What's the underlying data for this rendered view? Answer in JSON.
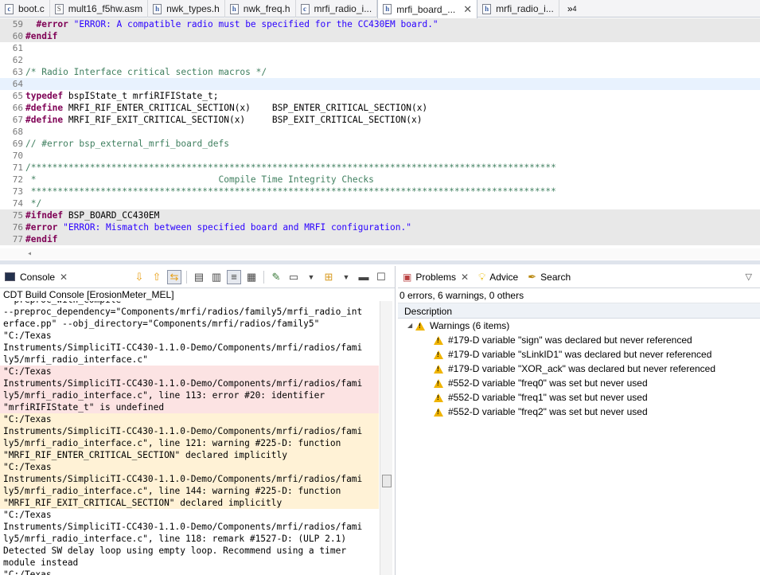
{
  "editor_tabs": [
    {
      "label": "boot.c",
      "icon": "c-file-icon"
    },
    {
      "label": "mult16_f5hw.asm",
      "icon": "asm-file-icon"
    },
    {
      "label": "nwk_types.h",
      "icon": "header-file-icon"
    },
    {
      "label": "nwk_freq.h",
      "icon": "header-file-icon"
    },
    {
      "label": "mrfi_radio_i...",
      "icon": "c-file-icon"
    },
    {
      "label": "mrfi_board_...",
      "icon": "header-file-icon",
      "active": true
    },
    {
      "label": "mrfi_radio_i...",
      "icon": "header-file-icon"
    }
  ],
  "tab_overflow": {
    "glyph": "»",
    "count": "4"
  },
  "code_lines": [
    {
      "n": "59",
      "text": "  #error \"ERROR: A compatible radio must be specified for the CC430EM board.\"",
      "style": "grey"
    },
    {
      "n": "60",
      "text": "#endif",
      "style": "grey"
    },
    {
      "n": "61",
      "text": "",
      "style": ""
    },
    {
      "n": "62",
      "text": "",
      "style": ""
    },
    {
      "n": "63",
      "text": "/* Radio Interface critical section macros */",
      "style": ""
    },
    {
      "n": "64",
      "text": "",
      "style": "cur"
    },
    {
      "n": "65",
      "text": "typedef bspIState_t mrfiRIFIState_t;",
      "style": ""
    },
    {
      "n": "66",
      "text": "#define MRFI_RIF_ENTER_CRITICAL_SECTION(x)    BSP_ENTER_CRITICAL_SECTION(x)",
      "style": ""
    },
    {
      "n": "67",
      "text": "#define MRFI_RIF_EXIT_CRITICAL_SECTION(x)     BSP_EXIT_CRITICAL_SECTION(x)",
      "style": ""
    },
    {
      "n": "68",
      "text": "",
      "style": ""
    },
    {
      "n": "69",
      "text": "// #error bsp_external_mrfi_board_defs",
      "style": ""
    },
    {
      "n": "70",
      "text": "",
      "style": ""
    },
    {
      "n": "71",
      "text": "/**************************************************************************************************",
      "style": ""
    },
    {
      "n": "72",
      "text": " *                                  Compile Time Integrity Checks",
      "style": ""
    },
    {
      "n": "73",
      "text": " **************************************************************************************************",
      "style": ""
    },
    {
      "n": "74",
      "text": " */",
      "style": ""
    },
    {
      "n": "75",
      "text": "#ifndef BSP_BOARD_CC430EM",
      "style": "grey"
    },
    {
      "n": "76",
      "text": "#error \"ERROR: Mismatch between specified board and MRFI configuration.\"",
      "style": "grey"
    },
    {
      "n": "77",
      "text": "#endif",
      "style": "grey"
    }
  ],
  "console": {
    "tab_label": "Console",
    "title": "CDT Build Console [ErosionMeter_MEL]",
    "lines": [
      {
        "text": "--preproc_with_compile",
        "kind": ""
      },
      {
        "text": "--preproc_dependency=\"Components/mrfi/radios/family5/mrfi_radio_int",
        "kind": ""
      },
      {
        "text": "erface.pp\" --obj_directory=\"Components/mrfi/radios/family5\"",
        "kind": ""
      },
      {
        "text": "\"C:/Texas",
        "kind": ""
      },
      {
        "text": "Instruments/SimpliciTI-CC430-1.1.0-Demo/Components/mrfi/radios/fami",
        "kind": ""
      },
      {
        "text": "ly5/mrfi_radio_interface.c\"",
        "kind": ""
      },
      {
        "text": "\"C:/Texas",
        "kind": "err"
      },
      {
        "text": "Instruments/SimpliciTI-CC430-1.1.0-Demo/Components/mrfi/radios/fami",
        "kind": "err"
      },
      {
        "text": "ly5/mrfi_radio_interface.c\", line 113: error #20: identifier",
        "kind": "err"
      },
      {
        "text": "\"mrfiRIFIState_t\" is undefined",
        "kind": "err"
      },
      {
        "text": "\"C:/Texas",
        "kind": "warn"
      },
      {
        "text": "Instruments/SimpliciTI-CC430-1.1.0-Demo/Components/mrfi/radios/fami",
        "kind": "warn"
      },
      {
        "text": "ly5/mrfi_radio_interface.c\", line 121: warning #225-D: function",
        "kind": "warn"
      },
      {
        "text": "\"MRFI_RIF_ENTER_CRITICAL_SECTION\" declared implicitly",
        "kind": "warn"
      },
      {
        "text": "\"C:/Texas",
        "kind": "warn"
      },
      {
        "text": "Instruments/SimpliciTI-CC430-1.1.0-Demo/Components/mrfi/radios/fami",
        "kind": "warn"
      },
      {
        "text": "ly5/mrfi_radio_interface.c\", line 144: warning #225-D: function",
        "kind": "warn"
      },
      {
        "text": "\"MRFI_RIF_EXIT_CRITICAL_SECTION\" declared implicitly",
        "kind": "warn"
      },
      {
        "text": "\"C:/Texas",
        "kind": ""
      },
      {
        "text": "Instruments/SimpliciTI-CC430-1.1.0-Demo/Components/mrfi/radios/fami",
        "kind": ""
      },
      {
        "text": "ly5/mrfi_radio_interface.c\", line 118: remark #1527-D: (ULP 2.1)",
        "kind": ""
      },
      {
        "text": "Detected SW delay loop using empty loop. Recommend using a timer",
        "kind": ""
      },
      {
        "text": "module instead",
        "kind": ""
      },
      {
        "text": "\"C:/Texas",
        "kind": ""
      }
    ]
  },
  "problems": {
    "tabs": [
      {
        "label": "Problems",
        "icon": "problems-icon",
        "active": true
      },
      {
        "label": "Advice",
        "icon": "lightbulb-icon"
      },
      {
        "label": "Search",
        "icon": "search-icon"
      }
    ],
    "summary": "0 errors, 6 warnings, 0 others",
    "column": "Description",
    "group": "Warnings (6 items)",
    "items": [
      "#179-D variable \"sign\" was declared but never referenced",
      "#179-D variable \"sLinkID1\" was declared but never referenced",
      "#179-D variable \"XOR_ack\" was declared but never referenced",
      "#552-D variable \"freq0\" was set but never used",
      "#552-D variable \"freq1\" was set but never used",
      "#552-D variable \"freq2\" was set but never used"
    ]
  },
  "colors": {
    "error_bg": "#fce3e3",
    "warning_bg": "#fff2d6",
    "keyword": "#7f0055",
    "string": "#2a00ff",
    "comment": "#3f7f5f"
  }
}
